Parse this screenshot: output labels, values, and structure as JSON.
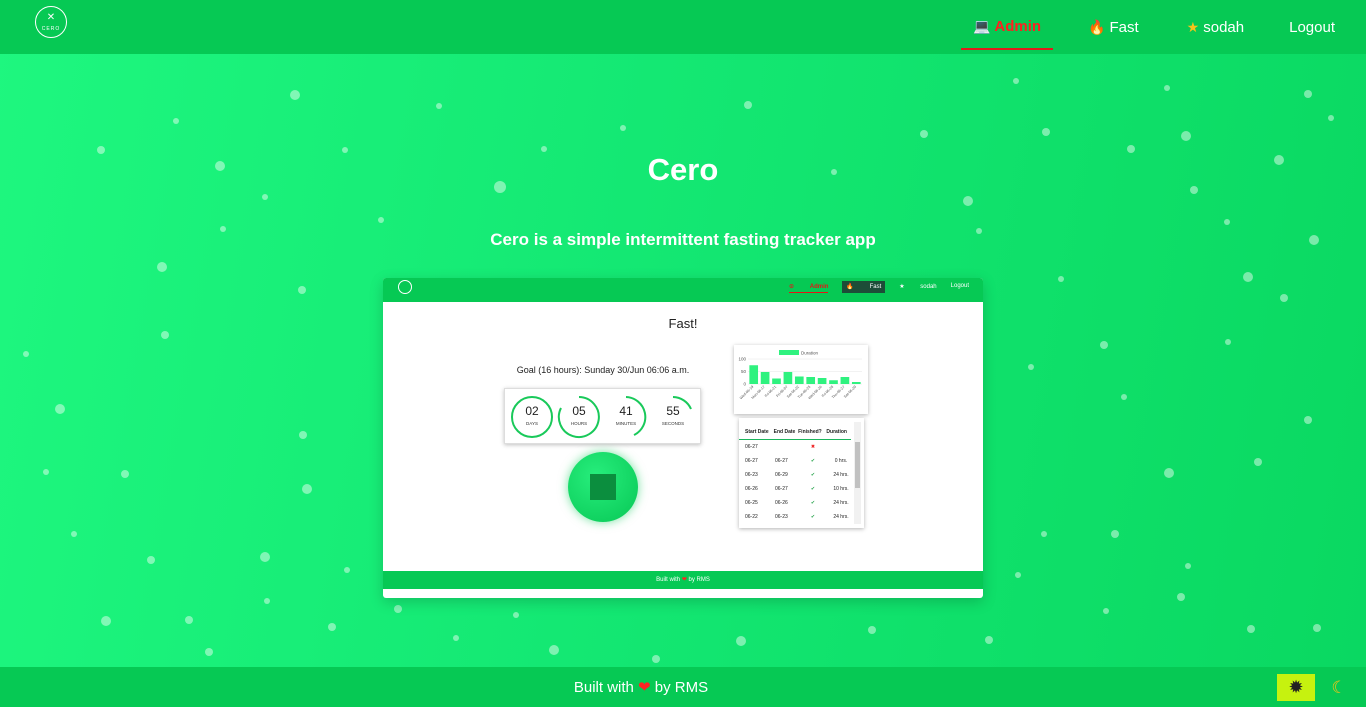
{
  "nav": {
    "logo_text": "CERO",
    "links": [
      {
        "label": "Admin",
        "icon": "laptop-icon"
      },
      {
        "label": "Fast",
        "icon": "fire-icon"
      },
      {
        "label": "sodah",
        "icon": "star-icon"
      },
      {
        "label": "Logout",
        "icon": ""
      }
    ],
    "active_color": "#e21b1b"
  },
  "hero": {
    "title": "Cero",
    "subtitle": "Cero is a simple intermittent fasting tracker app"
  },
  "preview": {
    "nav": {
      "admin": "Admin",
      "fast": "Fast",
      "user": "sodah",
      "logout": "Logout"
    },
    "title": "Fast!",
    "goal": "Goal (16 hours): Sunday 30/Jun 06:06 a.m.",
    "timer": [
      {
        "value": "02",
        "label": "DAYS"
      },
      {
        "value": "05",
        "label": "HOURS"
      },
      {
        "value": "41",
        "label": "MINUTES"
      },
      {
        "value": "55",
        "label": "SECONDS"
      }
    ],
    "table": {
      "headers": [
        "Start Date",
        "End Date",
        "Finished?",
        "Duration"
      ],
      "rows": [
        [
          "06-27",
          "",
          "✖",
          ""
        ],
        [
          "06-27",
          "06-27",
          "✔",
          "0 hrs."
        ],
        [
          "06-23",
          "06-29",
          "✔",
          "24 hrs."
        ],
        [
          "06-26",
          "06-27",
          "✔",
          "10 hrs."
        ],
        [
          "06-25",
          "06-26",
          "✔",
          "24 hrs."
        ],
        [
          "06-22",
          "06-23",
          "✔",
          "24 hrs."
        ]
      ]
    },
    "footer_prefix": "Built with",
    "footer_suffix": "by RMS"
  },
  "chart_data": {
    "type": "bar",
    "categories": [
      "Wed-06-19",
      "Mon-06-17",
      "Fri-06-21",
      "Fri-06-07",
      "Sat-06-22",
      "Tue-06-25",
      "Wed-06-26",
      "Fri-06-28",
      "Thu-06-27",
      "Sat-06-29"
    ],
    "series": [
      {
        "name": "Duration",
        "values": [
          75,
          48,
          22,
          48,
          30,
          28,
          24,
          15,
          28,
          8
        ]
      }
    ],
    "ylim": [
      0,
      100
    ],
    "yticks": [
      0,
      50,
      100
    ],
    "legend": "top"
  },
  "footer": {
    "prefix": "Built with",
    "heart": "❤",
    "suffix": "by RMS",
    "theme_light_icon": "sun-icon",
    "theme_dark_icon": "moon-icon"
  }
}
